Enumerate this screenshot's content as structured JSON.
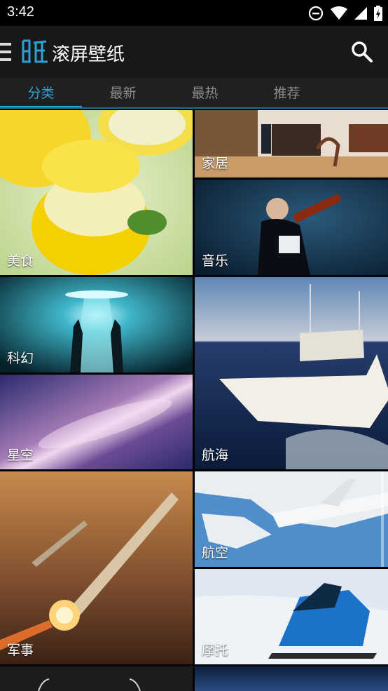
{
  "status_bar": {
    "time": "3:42",
    "icons": [
      "do-not-disturb-icon",
      "wifi-icon",
      "cell-signal-icon",
      "battery-charging-icon"
    ]
  },
  "app_bar": {
    "title": "滚屏壁纸",
    "logo_text": "纸",
    "menu_icon": "hamburger-menu-icon",
    "search_icon": "search-icon"
  },
  "tabs": [
    {
      "label": "分类",
      "active": true
    },
    {
      "label": "最新",
      "active": false
    },
    {
      "label": "最热",
      "active": false
    },
    {
      "label": "推荐",
      "active": false
    }
  ],
  "categories": {
    "food": "美食",
    "home": "家居",
    "music": "音乐",
    "scifi": "科幻",
    "sailing": "航海",
    "starry": "星空",
    "military": "军事",
    "aviation": "航空",
    "motor": "摩托"
  },
  "colors": {
    "accent": "#2aa2d6",
    "appbar": "#181818",
    "tabbar": "#202020"
  }
}
